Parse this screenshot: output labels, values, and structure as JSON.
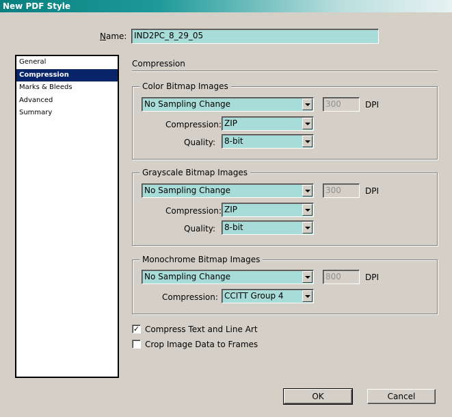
{
  "window": {
    "title": "New PDF Style"
  },
  "name": {
    "label": "Name:",
    "value": "IND2PC_8_29_05"
  },
  "sidebar": {
    "items": [
      {
        "label": "General",
        "selected": false
      },
      {
        "label": "Compression",
        "selected": true
      },
      {
        "label": "Marks & Bleeds",
        "selected": false
      },
      {
        "label": "Advanced",
        "selected": false
      },
      {
        "label": "Summary",
        "selected": false
      }
    ]
  },
  "section_title": "Compression",
  "color_bitmap": {
    "title": "Color Bitmap Images",
    "sampling": "No Sampling Change",
    "dpi_value": "300",
    "dpi_label": "DPI",
    "compression_label": "Compression:",
    "compression": "ZIP",
    "quality_label": "Quality:",
    "quality": "8-bit"
  },
  "grayscale_bitmap": {
    "title": "Grayscale Bitmap Images",
    "sampling": "No Sampling Change",
    "dpi_value": "300",
    "dpi_label": "DPI",
    "compression_label": "Compression:",
    "compression": "ZIP",
    "quality_label": "Quality:",
    "quality": "8-bit"
  },
  "mono_bitmap": {
    "title": "Monochrome Bitmap Images",
    "sampling": "No Sampling Change",
    "dpi_value": "800",
    "dpi_label": "DPI",
    "compression_label": "Compression:",
    "compression": "CCITT Group 4"
  },
  "options": {
    "compress_text": {
      "label": "Compress Text and Line Art",
      "checked": true,
      "mark": "✓"
    },
    "crop_image": {
      "label": "Crop Image Data to Frames",
      "checked": false
    }
  },
  "buttons": {
    "ok": "OK",
    "cancel": "Cancel"
  }
}
